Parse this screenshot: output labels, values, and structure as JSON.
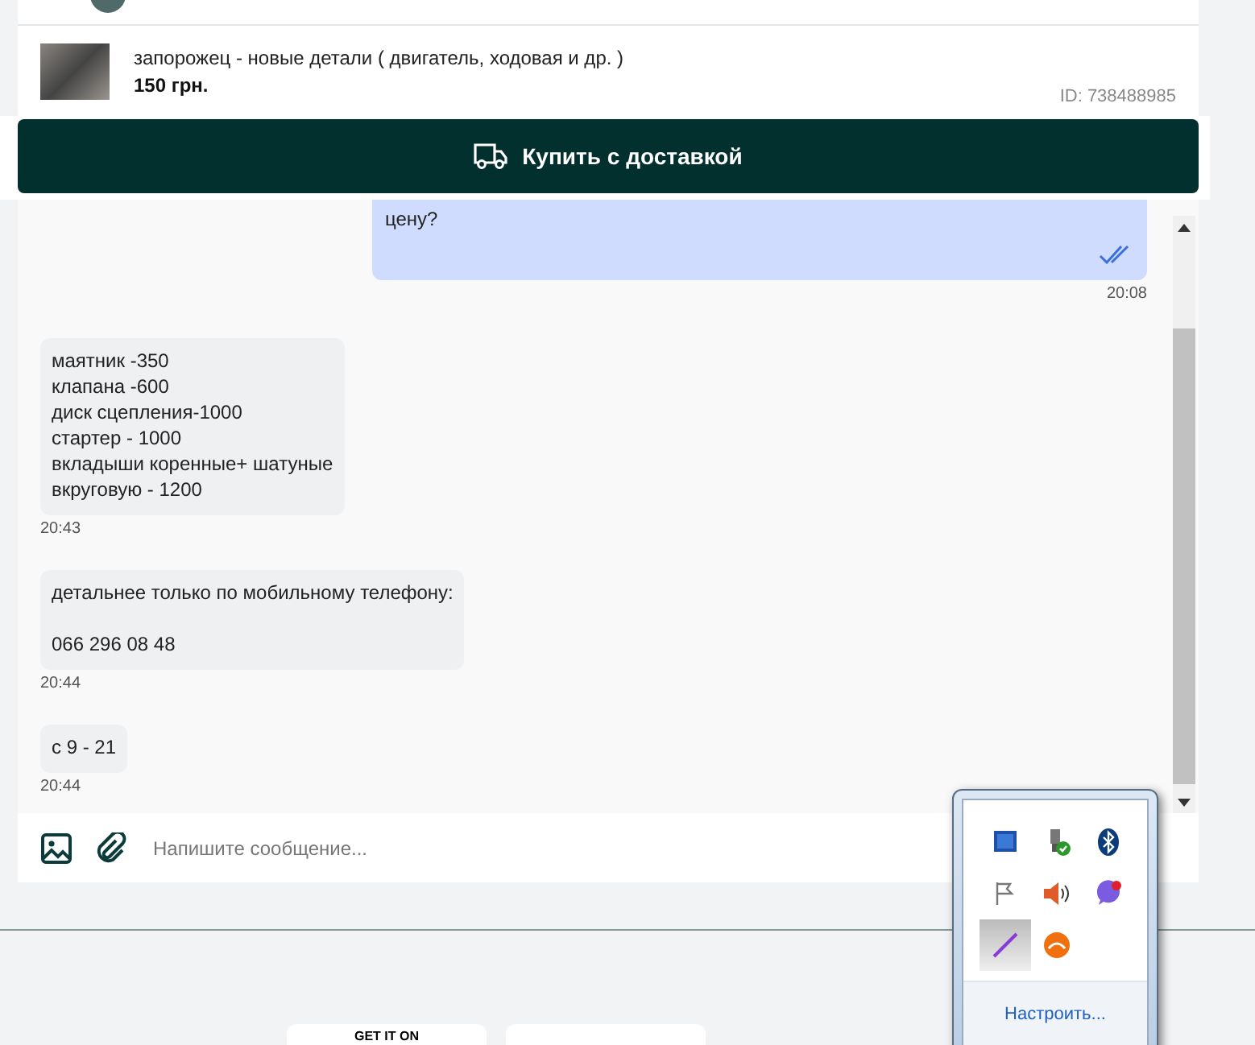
{
  "product": {
    "title": "запорожец - новые детали ( двигатель, ходовая и др. )",
    "price": "150 грн.",
    "id": "ID: 738488985"
  },
  "buy_button": {
    "label": "Купить с доставкой"
  },
  "messages": [
    {
      "kind": "outgoing",
      "text": "цену?",
      "time": "20:08",
      "read": true
    },
    {
      "kind": "incoming",
      "text": "маятник -350\nклапана -600\nдиск сцепления-1000\nстартер - 1000\nвкладыши коренные+ шатуные\nвкруговую - 1200",
      "time": "20:43"
    },
    {
      "kind": "incoming",
      "text": "детальнее только по мобильному телефону:\n\n066 296 08 48",
      "time": "20:44"
    },
    {
      "kind": "incoming",
      "text": "с 9 - 21",
      "time": "20:44"
    }
  ],
  "composer": {
    "placeholder": "Напишите сообщение..."
  },
  "store_badges": [
    {
      "label": "GET IT ON"
    }
  ],
  "tray": {
    "icons": [
      {
        "kind": "display",
        "selected": false
      },
      {
        "kind": "usb",
        "selected": false
      },
      {
        "kind": "bluetooth",
        "selected": false
      },
      {
        "kind": "flag",
        "selected": false
      },
      {
        "kind": "speaker",
        "selected": false
      },
      {
        "kind": "phone",
        "selected": false
      },
      {
        "kind": "pen",
        "selected": true
      },
      {
        "kind": "cloud",
        "selected": false
      }
    ],
    "link": "Настроить..."
  }
}
